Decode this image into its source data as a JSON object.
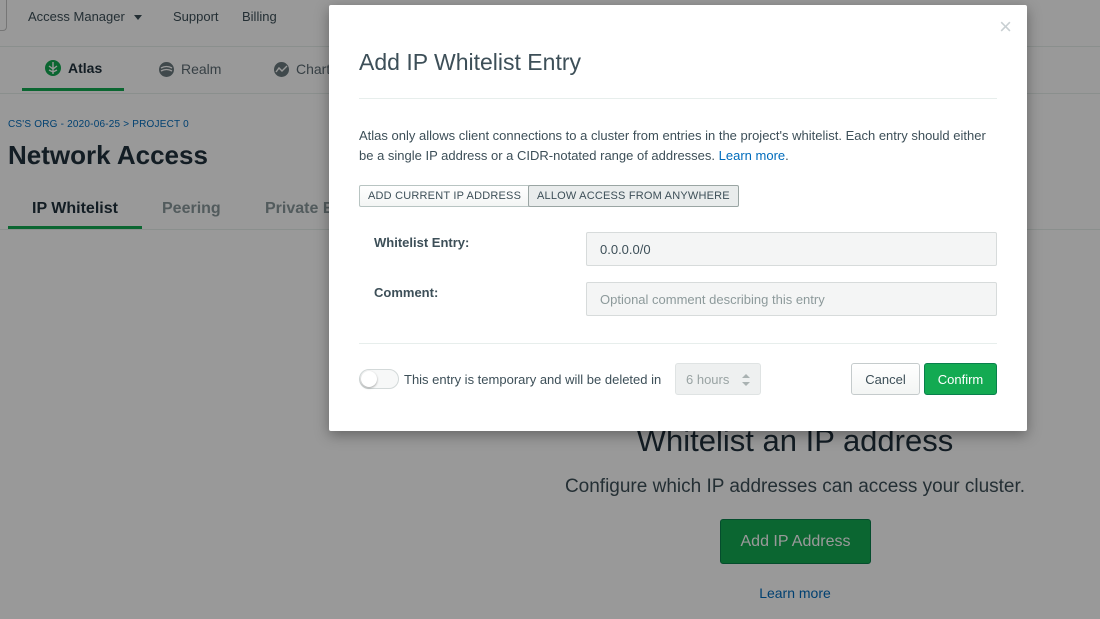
{
  "topnav": {
    "access_manager": "Access Manager",
    "support": "Support",
    "billing": "Billing"
  },
  "prodnav": {
    "atlas": "Atlas",
    "realm": "Realm",
    "charts": "Charts"
  },
  "breadcrumb": "CS'S ORG - 2020-06-25 > PROJECT 0",
  "page_title": "Network Access",
  "subtabs": {
    "ip_whitelist": "IP Whitelist",
    "peering": "Peering",
    "private": "Private E"
  },
  "empty_state": {
    "title": "Whitelist an IP address",
    "subtitle": "Configure which IP addresses can access your cluster.",
    "button": "Add IP Address",
    "link": "Learn more"
  },
  "modal": {
    "title": "Add IP Whitelist Entry",
    "close": "×",
    "description": "Atlas only allows client connections to a cluster from entries in the project's whitelist. Each entry should either be a single IP address or a CIDR-notated range of addresses.",
    "learn_more": "Learn more",
    "add_current_ip": "ADD CURRENT IP ADDRESS",
    "allow_anywhere": "ALLOW ACCESS FROM ANYWHERE",
    "whitelist_label": "Whitelist Entry:",
    "whitelist_value": "0.0.0.0/0",
    "comment_label": "Comment:",
    "comment_placeholder": "Optional comment describing this entry",
    "temporary_text": "This entry is temporary and will be deleted in",
    "temporary_on": false,
    "duration": "6 hours",
    "cancel": "Cancel",
    "confirm": "Confirm"
  },
  "colors": {
    "accent_green": "#13aa52",
    "link_blue": "#006cbc"
  }
}
